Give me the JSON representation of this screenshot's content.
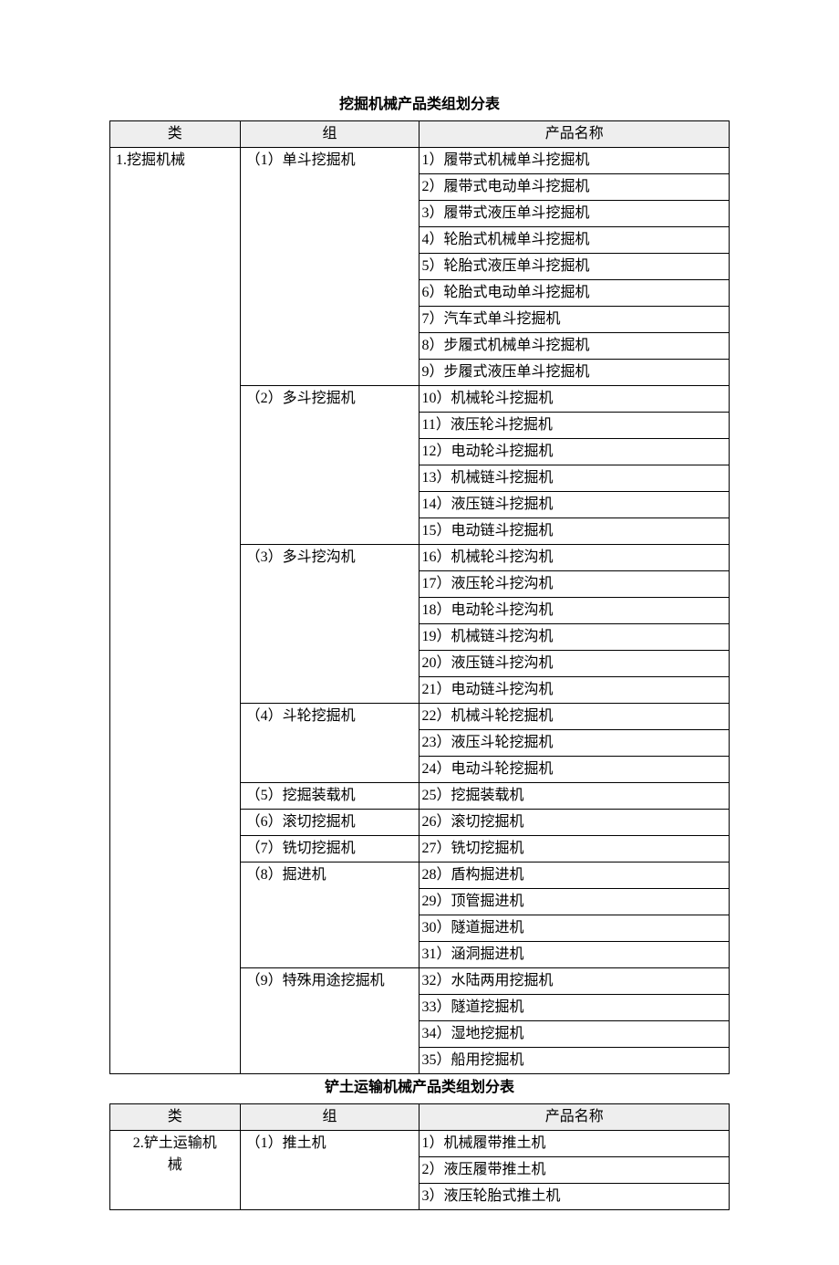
{
  "tables": [
    {
      "title": "挖掘机械产品类组划分表",
      "headers": [
        "类",
        "组",
        "产品名称"
      ],
      "category": "1.挖掘机械",
      "category_align": "left",
      "groups": [
        {
          "label": "（1）单斗挖掘机",
          "products": [
            "1）履带式机械单斗挖掘机",
            "2）履带式电动单斗挖掘机",
            "3）履带式液压单斗挖掘机",
            "4）轮胎式机械单斗挖掘机",
            "5）轮胎式液压单斗挖掘机",
            "6）轮胎式电动单斗挖掘机",
            "7）汽车式单斗挖掘机",
            "8）步履式机械单斗挖掘机",
            "9）步履式液压单斗挖掘机"
          ]
        },
        {
          "label": "（2）多斗挖掘机",
          "products": [
            "10）机械轮斗挖掘机",
            "11）液压轮斗挖掘机",
            "12）电动轮斗挖掘机",
            "13）机械链斗挖掘机",
            "14）液压链斗挖掘机",
            "15）电动链斗挖掘机"
          ]
        },
        {
          "label": "（3）多斗挖沟机",
          "products": [
            "16）机械轮斗挖沟机",
            "17）液压轮斗挖沟机",
            "18）电动轮斗挖沟机",
            "19）机械链斗挖沟机",
            "20）液压链斗挖沟机",
            "21）电动链斗挖沟机"
          ]
        },
        {
          "label": "（4）斗轮挖掘机",
          "products": [
            "22）机械斗轮挖掘机",
            "23）液压斗轮挖掘机",
            "24）电动斗轮挖掘机"
          ]
        },
        {
          "label": "（5）挖掘装载机",
          "products": [
            "25）挖掘装载机"
          ]
        },
        {
          "label": "（6）滚切挖掘机",
          "products": [
            "26）滚切挖掘机"
          ]
        },
        {
          "label": "（7）铣切挖掘机",
          "products": [
            "27）铣切挖掘机"
          ]
        },
        {
          "label": "（8）掘进机",
          "products": [
            "28）盾构掘进机",
            "29）顶管掘进机",
            "30）隧道掘进机",
            "31）涵洞掘进机"
          ]
        },
        {
          "label": "（9）特殊用途挖掘机",
          "products": [
            "32）水陆两用挖掘机",
            "33）隧道挖掘机",
            "34）湿地挖掘机",
            "35）船用挖掘机"
          ]
        }
      ]
    },
    {
      "title": "铲土运输机械产品类组划分表",
      "headers": [
        "类",
        "组",
        "产品名称"
      ],
      "category": "2.铲土运输机械",
      "category_align": "center",
      "groups": [
        {
          "label": "（1）推土机",
          "products": [
            "1）机械履带推土机",
            "2）液压履带推土机",
            "3）液压轮胎式推土机"
          ]
        }
      ]
    }
  ]
}
